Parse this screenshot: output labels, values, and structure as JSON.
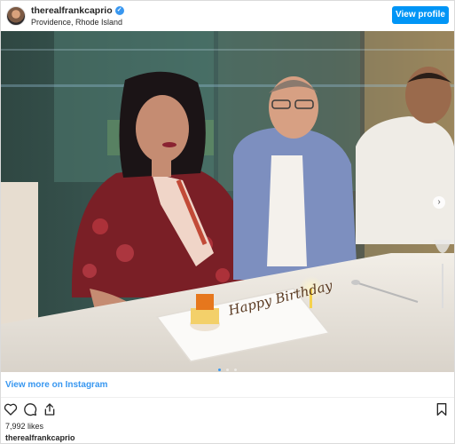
{
  "header": {
    "username": "therealfrankcaprio",
    "location": "Providence, Rhode Island",
    "view_profile_label": "View profile"
  },
  "photo": {
    "cake_text": "Happy Birthday",
    "carousel_count": 3,
    "carousel_active_index": 0
  },
  "footer": {
    "view_more_label": "View more on Instagram",
    "likes_text": "7,992 likes",
    "username": "therealfrankcaprio"
  },
  "icons": {
    "like": "heart-icon",
    "comment": "comment-icon",
    "share": "share-icon",
    "save": "bookmark-icon",
    "verified": "verified-icon",
    "next": "chevron-right-icon"
  },
  "colors": {
    "accent": "#3897f0",
    "button": "#0095f6",
    "text": "#262626"
  }
}
